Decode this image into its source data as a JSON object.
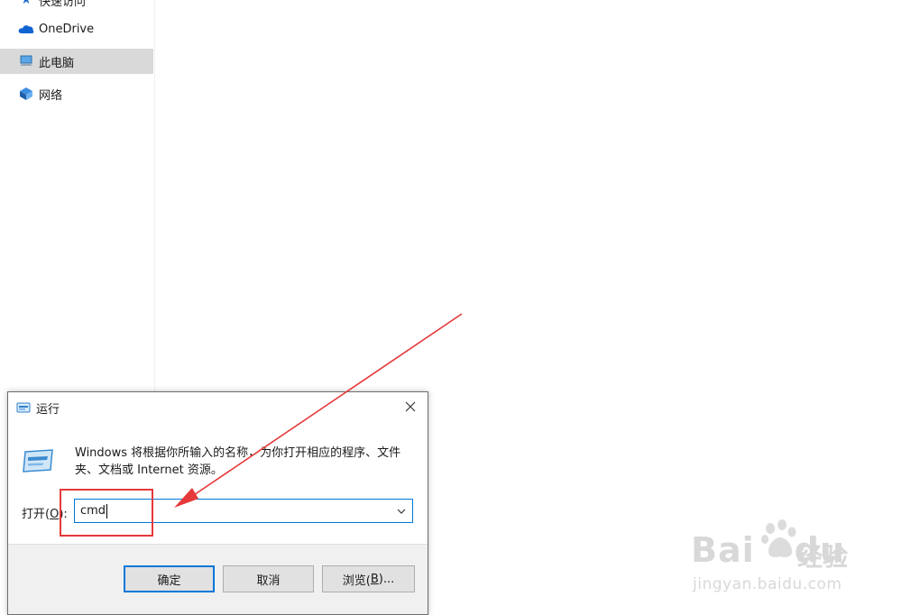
{
  "nav": {
    "items": [
      {
        "label": "快速访问",
        "icon": "star-icon"
      },
      {
        "label": "OneDrive",
        "icon": "cloud-icon"
      },
      {
        "label": "此电脑",
        "icon": "computer-icon",
        "selected": true
      },
      {
        "label": "网络",
        "icon": "network-icon"
      }
    ]
  },
  "dialog": {
    "title": "运行",
    "description": "Windows 将根据你所输入的名称，为你打开相应的程序、文件夹、文档或 Internet 资源。",
    "open_label_prefix": "打开(",
    "open_label_key": "O",
    "open_label_suffix": "):",
    "input_value": "cmd",
    "buttons": {
      "ok": "确定",
      "cancel": "取消",
      "browse_prefix": "浏览(",
      "browse_key": "B",
      "browse_suffix": ")..."
    }
  },
  "watermark": {
    "brand": "Bai",
    "brand2": "du",
    "cn": "经验",
    "url": "jingyan.baidu.com"
  },
  "colors": {
    "annotation": "#e5393a",
    "focus": "#0078d7",
    "selection": "#d9d9d9"
  }
}
